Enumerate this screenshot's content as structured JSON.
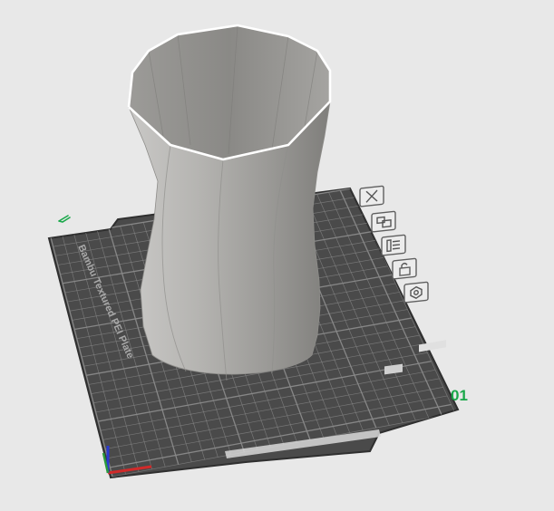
{
  "viewport": {
    "background": "#e8e8e8",
    "plate": {
      "name_text": "Bambu Textured PEI Plate",
      "number_text": "01",
      "number_color": "#1aa84a",
      "edit_marker": "pencil-icon",
      "fill_color": "#4a4a4a",
      "grid_color": "#8a8a8a"
    },
    "plate_buttons": [
      {
        "id": "delete",
        "icon": "close-icon"
      },
      {
        "id": "arrange",
        "icon": "arrange-icon"
      },
      {
        "id": "objects",
        "icon": "object-list-icon"
      },
      {
        "id": "lock",
        "icon": "lock-icon"
      },
      {
        "id": "settings",
        "icon": "settings-hex-icon"
      }
    ],
    "model": {
      "icon": "vase-model",
      "color": "#a3a19e"
    },
    "axes": {
      "x_color": "#d12a2a",
      "y_color": "#2a9a3a",
      "z_color": "#2a3ad1"
    }
  }
}
